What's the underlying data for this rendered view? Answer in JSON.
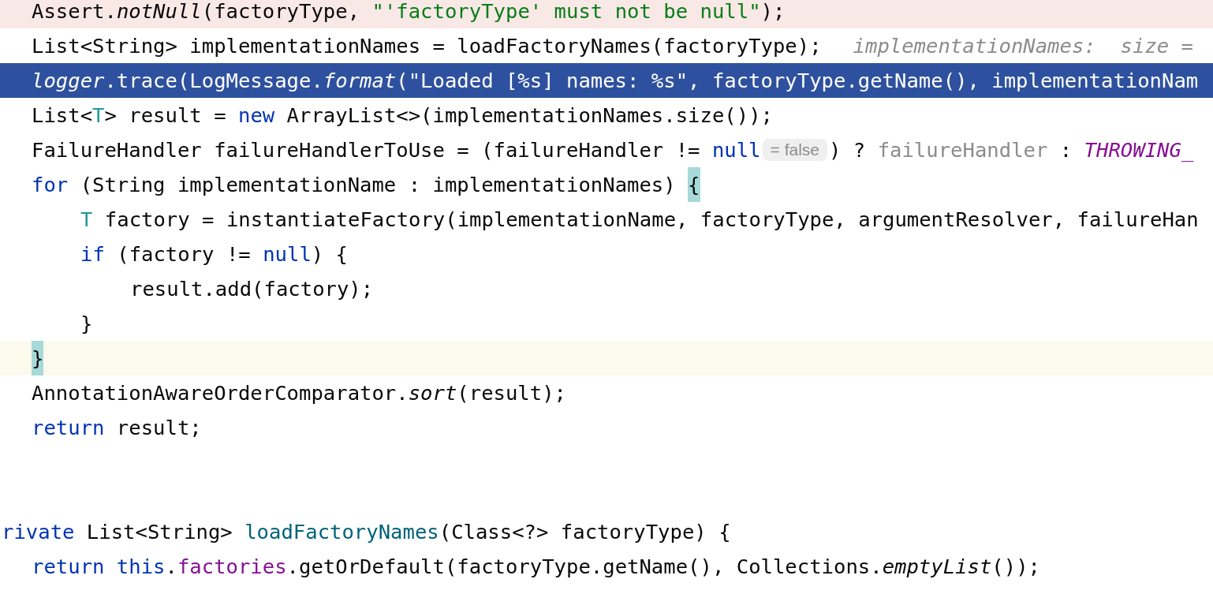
{
  "editor": {
    "blocks": [
      {
        "lines": [
          {
            "kind": "breakpoint",
            "tokens": [
              {
                "kind": "plain",
                "text": "Assert."
              },
              {
                "kind": "static",
                "text": "notNull"
              },
              {
                "kind": "plain",
                "text": "(factoryType, "
              },
              {
                "kind": "string",
                "text": "\"'factoryType' must not be null\""
              },
              {
                "kind": "plain",
                "text": ");"
              }
            ]
          },
          {
            "tokens": [
              {
                "kind": "plain",
                "text": "List<String> implementationNames = loadFactoryNames(factoryType);"
              },
              {
                "kind": "hint",
                "text": "implementationNames:  size ="
              }
            ]
          },
          {
            "kind": "execution",
            "tokens": [
              {
                "kind": "static",
                "text": "logger"
              },
              {
                "kind": "plain",
                "text": ".trace(LogMessage."
              },
              {
                "kind": "static",
                "text": "format"
              },
              {
                "kind": "plain",
                "text": "(\"Loaded [%s] names: %s\", factoryType.getName(), implementationNam"
              }
            ]
          },
          {
            "tokens": [
              {
                "kind": "plain",
                "text": "List<"
              },
              {
                "kind": "type-param",
                "text": "T"
              },
              {
                "kind": "plain",
                "text": "> result = "
              },
              {
                "kind": "keyword",
                "text": "new"
              },
              {
                "kind": "plain",
                "text": " ArrayList<>(implementationNames.size());"
              }
            ]
          },
          {
            "tokens": [
              {
                "kind": "plain",
                "text": "FailureHandler failureHandlerToUse = (failureHandler != "
              },
              {
                "kind": "keyword",
                "text": "null"
              },
              {
                "kind": "inlay",
                "text": "= false"
              },
              {
                "kind": "plain",
                "text": ") ? "
              },
              {
                "kind": "muted",
                "text": "failureHandler"
              },
              {
                "kind": "plain",
                "text": " : "
              },
              {
                "kind": "constant",
                "text": "THROWING_"
              }
            ]
          },
          {
            "tokens": [
              {
                "kind": "keyword",
                "text": "for"
              },
              {
                "kind": "plain",
                "text": " (String implementationName : implementationNames) "
              },
              {
                "kind": "brace",
                "text": "{"
              }
            ],
            "children": [
              {
                "tokens": [
                  {
                    "kind": "type-param",
                    "text": "T"
                  },
                  {
                    "kind": "plain",
                    "text": " factory = instantiateFactory(implementationName, factoryType, argumentResolver, failureHan"
                  }
                ]
              },
              {
                "tokens": [
                  {
                    "kind": "keyword",
                    "text": "if"
                  },
                  {
                    "kind": "plain",
                    "text": " (factory != "
                  },
                  {
                    "kind": "keyword",
                    "text": "null"
                  },
                  {
                    "kind": "plain",
                    "text": ") {"
                  }
                ],
                "children": [
                  {
                    "tokens": [
                      {
                        "kind": "plain",
                        "text": "result.add(factory);"
                      }
                    ]
                  }
                ]
              },
              {
                "tokens": [
                  {
                    "kind": "plain",
                    "text": "}"
                  }
                ]
              }
            ]
          },
          {
            "kind": "caret",
            "tokens": [
              {
                "kind": "brace",
                "text": "}"
              }
            ]
          },
          {
            "tokens": [
              {
                "kind": "plain",
                "text": "AnnotationAwareOrderComparator."
              },
              {
                "kind": "static",
                "text": "sort"
              },
              {
                "kind": "plain",
                "text": "(result);"
              }
            ]
          },
          {
            "tokens": [
              {
                "kind": "keyword",
                "text": "return"
              },
              {
                "kind": "plain",
                "text": " result;"
              }
            ]
          }
        ]
      },
      {
        "header": {
          "tokens": [
            {
              "kind": "keyword",
              "text": "rivate"
            },
            {
              "kind": "plain",
              "text": " List<String> "
            },
            {
              "kind": "method-decl",
              "text": "loadFactoryNames"
            },
            {
              "kind": "plain",
              "text": "(Class<?> factoryType) {"
            }
          ]
        },
        "lines": [
          {
            "tokens": [
              {
                "kind": "keyword",
                "text": "return this"
              },
              {
                "kind": "plain",
                "text": "."
              },
              {
                "kind": "field",
                "text": "factories"
              },
              {
                "kind": "plain",
                "text": ".getOrDefault(factoryType.getName(), Collections."
              },
              {
                "kind": "static",
                "text": "emptyList"
              },
              {
                "kind": "plain",
                "text": "());"
              }
            ]
          }
        ]
      }
    ]
  }
}
